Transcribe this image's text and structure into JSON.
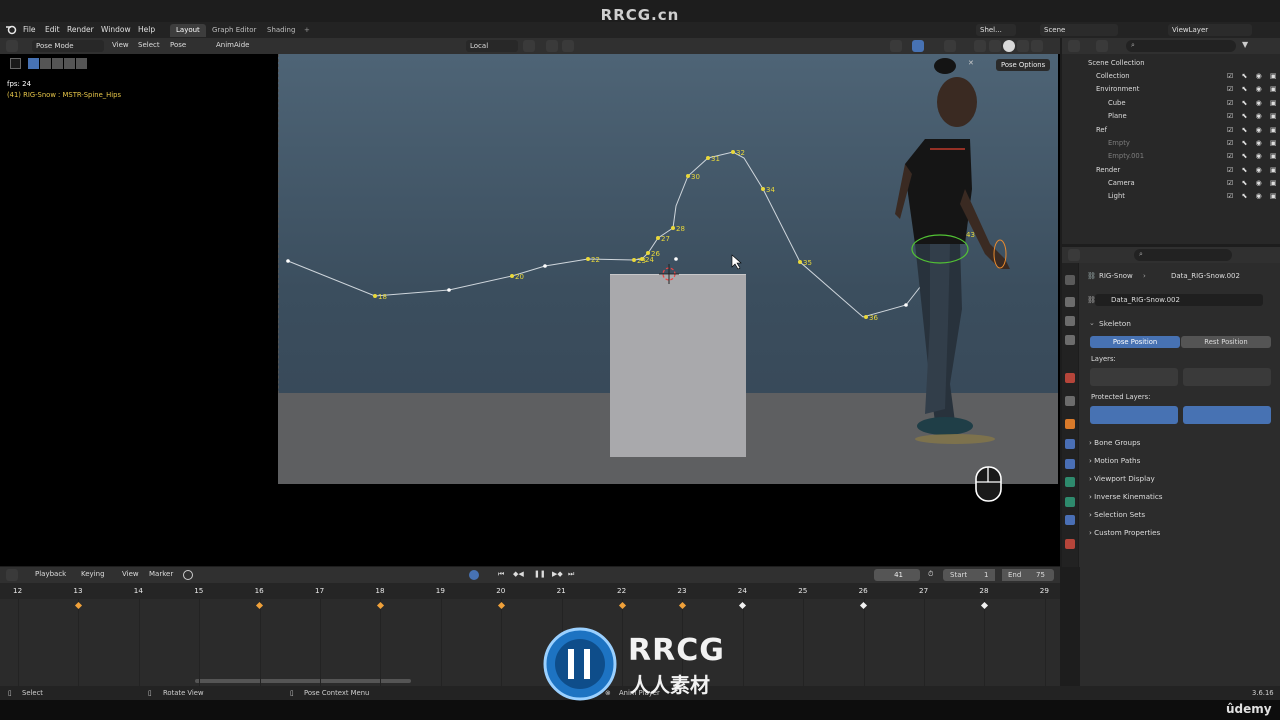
{
  "watermark": {
    "top": "RRCG.cn",
    "logo_main": "RRCG",
    "logo_sub": "人人素材",
    "udemy": "ûdemy"
  },
  "menubar": {
    "items": [
      "File",
      "Edit",
      "Render",
      "Window",
      "Help"
    ],
    "workspaces": [
      "Layout",
      "Graph Editor",
      "Shading"
    ],
    "active_workspace": "Layout",
    "shelf": "Shel...",
    "scene": "Scene",
    "view_layer": "ViewLayer"
  },
  "viewport_header": {
    "mode": "Pose Mode",
    "menus": [
      "View",
      "Select",
      "Pose"
    ],
    "addon": "AnimAide",
    "orientation": "Local"
  },
  "viewport": {
    "fps": "fps: 24",
    "status": "(41) RIG-Snow : MSTR-Spine_Hips",
    "pose_options": "Pose Options",
    "motion_labels": [
      "18",
      "20",
      "22",
      "23",
      "24",
      "26",
      "27",
      "28",
      "30",
      "31",
      "32",
      "34",
      "35",
      "36",
      "41",
      "43"
    ]
  },
  "outliner": {
    "rows": [
      {
        "label": "Scene Collection",
        "indent": 0,
        "dim": false
      },
      {
        "label": "Collection",
        "indent": 1,
        "dim": false
      },
      {
        "label": "Environment",
        "indent": 1,
        "dim": false
      },
      {
        "label": "Cube",
        "indent": 2,
        "dim": false
      },
      {
        "label": "Plane",
        "indent": 2,
        "dim": false
      },
      {
        "label": "Ref",
        "indent": 1,
        "dim": false
      },
      {
        "label": "Empty",
        "indent": 2,
        "dim": true
      },
      {
        "label": "Empty.001",
        "indent": 2,
        "dim": true
      },
      {
        "label": "Render",
        "indent": 1,
        "dim": false
      },
      {
        "label": "Camera",
        "indent": 2,
        "dim": false
      },
      {
        "label": "Light",
        "indent": 2,
        "dim": false
      }
    ]
  },
  "properties": {
    "breadcrumb_obj": "RIG-Snow",
    "breadcrumb_data": "Data_RIG-Snow.002",
    "data_name": "Data_RIG-Snow.002",
    "skeleton": "Skeleton",
    "pose_position": "Pose Position",
    "rest_position": "Rest Position",
    "layers": "Layers:",
    "protected_layers": "Protected Layers:",
    "panels": [
      "Bone Groups",
      "Motion Paths",
      "Viewport Display",
      "Inverse Kinematics",
      "Selection Sets",
      "Custom Properties"
    ]
  },
  "timeline": {
    "menus": [
      "Playback",
      "Keying",
      "View",
      "Marker"
    ],
    "current_frame": "41",
    "start_label": "Start",
    "start": "1",
    "end_label": "End",
    "end": "75",
    "ticks": [
      "12",
      "13",
      "14",
      "15",
      "16",
      "17",
      "18",
      "19",
      "20",
      "21",
      "22",
      "23",
      "24",
      "25",
      "26",
      "27",
      "28",
      "29"
    ]
  },
  "statusbar": {
    "select": "Select",
    "rotate": "Rotate View",
    "context": "Pose Context Menu",
    "anim_player": "Anim Player",
    "version": "3.6.16"
  },
  "colors": {
    "accent": "#4772b3",
    "key_orange": "#f0a13a",
    "key_white": "#f2f2f2",
    "path_label": "#e9d83a"
  }
}
